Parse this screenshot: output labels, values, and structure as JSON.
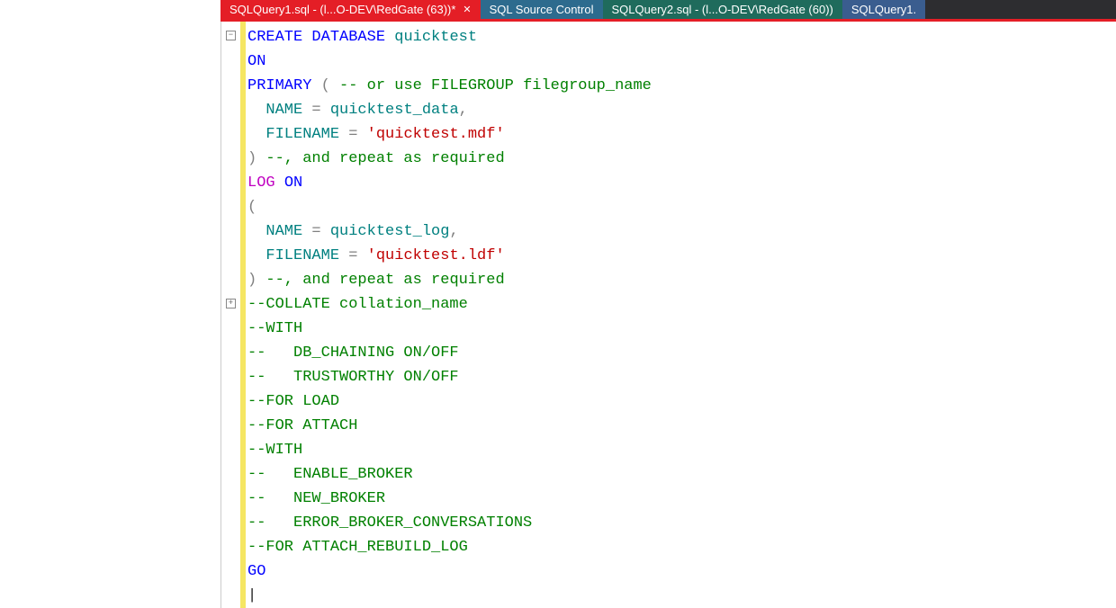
{
  "tabs": [
    {
      "label": "SQLQuery1.sql - (l...O-DEV\\RedGate (63))*"
    },
    {
      "label": "SQL Source Control"
    },
    {
      "label": "SQLQuery2.sql - (l...O-DEV\\RedGate (60))"
    },
    {
      "label": "SQLQuery1."
    }
  ],
  "code": {
    "l1": {
      "t1": "CREATE",
      "t2": " ",
      "t3": "DATABASE",
      "t4": " ",
      "t5": "quicktest"
    },
    "l2": {
      "t1": "ON"
    },
    "l3": {
      "t1": "PRIMARY",
      "t2": " ",
      "t3": "(",
      "t4": " ",
      "t5": "-- or use FILEGROUP filegroup_name"
    },
    "l4": {
      "t1": "  NAME",
      "t2": " ",
      "t3": "=",
      "t4": " ",
      "t5": "quicktest_data",
      "t6": ","
    },
    "l5": {
      "t1": "  FILENAME",
      "t2": " ",
      "t3": "=",
      "t4": " ",
      "t5": "'quicktest.mdf'"
    },
    "l6": {
      "t1": ")",
      "t2": " ",
      "t3": "--, and repeat as required"
    },
    "l7": {
      "t1": "LOG",
      "t2": " ",
      "t3": "ON"
    },
    "l8": {
      "t1": "("
    },
    "l9": {
      "t1": "  NAME",
      "t2": " ",
      "t3": "=",
      "t4": " ",
      "t5": "quicktest_log",
      "t6": ","
    },
    "l10": {
      "t1": "  FILENAME",
      "t2": " ",
      "t3": "=",
      "t4": " ",
      "t5": "'quicktest.ldf'"
    },
    "l11": {
      "t1": ")",
      "t2": " ",
      "t3": "--, and repeat as required"
    },
    "l12": {
      "t1": "--COLLATE collation_name"
    },
    "l13": {
      "t1": "--WITH"
    },
    "l14": {
      "t1": "--   DB_CHAINING ON/OFF"
    },
    "l15": {
      "t1": "--   TRUSTWORTHY ON/OFF"
    },
    "l16": {
      "t1": "--FOR LOAD"
    },
    "l17": {
      "t1": "--FOR ATTACH"
    },
    "l18": {
      "t1": "--WITH"
    },
    "l19": {
      "t1": "--   ENABLE_BROKER"
    },
    "l20": {
      "t1": "--   NEW_BROKER"
    },
    "l21": {
      "t1": "--   ERROR_BROKER_CONVERSATIONS"
    },
    "l22": {
      "t1": "--FOR ATTACH_REBUILD_LOG"
    },
    "l23": {
      "t1": "GO"
    },
    "l24": {
      "t1": "|"
    }
  }
}
